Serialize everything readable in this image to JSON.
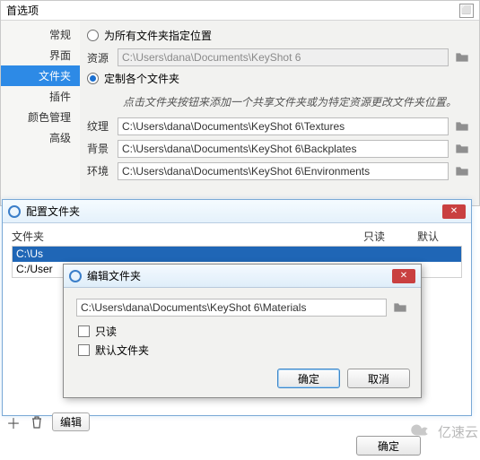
{
  "prefs": {
    "title": "首选项",
    "close": "⬜",
    "sidebar": [
      "常规",
      "界面",
      "文件夹",
      "插件",
      "颜色管理",
      "高级"
    ],
    "selected": 2,
    "radio1": "为所有文件夹指定位置",
    "radio2": "定制各个文件夹",
    "hint": "点击文件夹按钮来添加一个共享文件夹或为特定资源更改文件夹位置。",
    "rows": [
      {
        "lbl": "资源",
        "path": "C:\\Users\\dana\\Documents\\KeyShot 6",
        "disabled": true
      },
      {
        "lbl": "纹理",
        "path": "C:\\Users\\dana\\Documents\\KeyShot 6\\Textures",
        "disabled": false
      },
      {
        "lbl": "背景",
        "path": "C:\\Users\\dana\\Documents\\KeyShot 6\\Backplates",
        "disabled": false
      },
      {
        "lbl": "环境",
        "path": "C:\\Users\\dana\\Documents\\KeyShot 6\\Environments",
        "disabled": false
      }
    ]
  },
  "dlg": {
    "title": "配置文件夹",
    "cols": {
      "c1": "文件夹",
      "c2": "只读",
      "c3": "默认"
    },
    "rows": [
      "C:\\Us",
      "C:/User"
    ]
  },
  "edit": {
    "title": "编辑文件夹",
    "path": "C:\\Users\\dana\\Documents\\KeyShot 6\\Materials",
    "chk1": "只读",
    "chk2": "默认文件夹",
    "ok": "确定",
    "cancel": "取消"
  },
  "toolbar": {
    "edit": "编辑"
  },
  "mainOk": "确定",
  "brand": "亿速云"
}
